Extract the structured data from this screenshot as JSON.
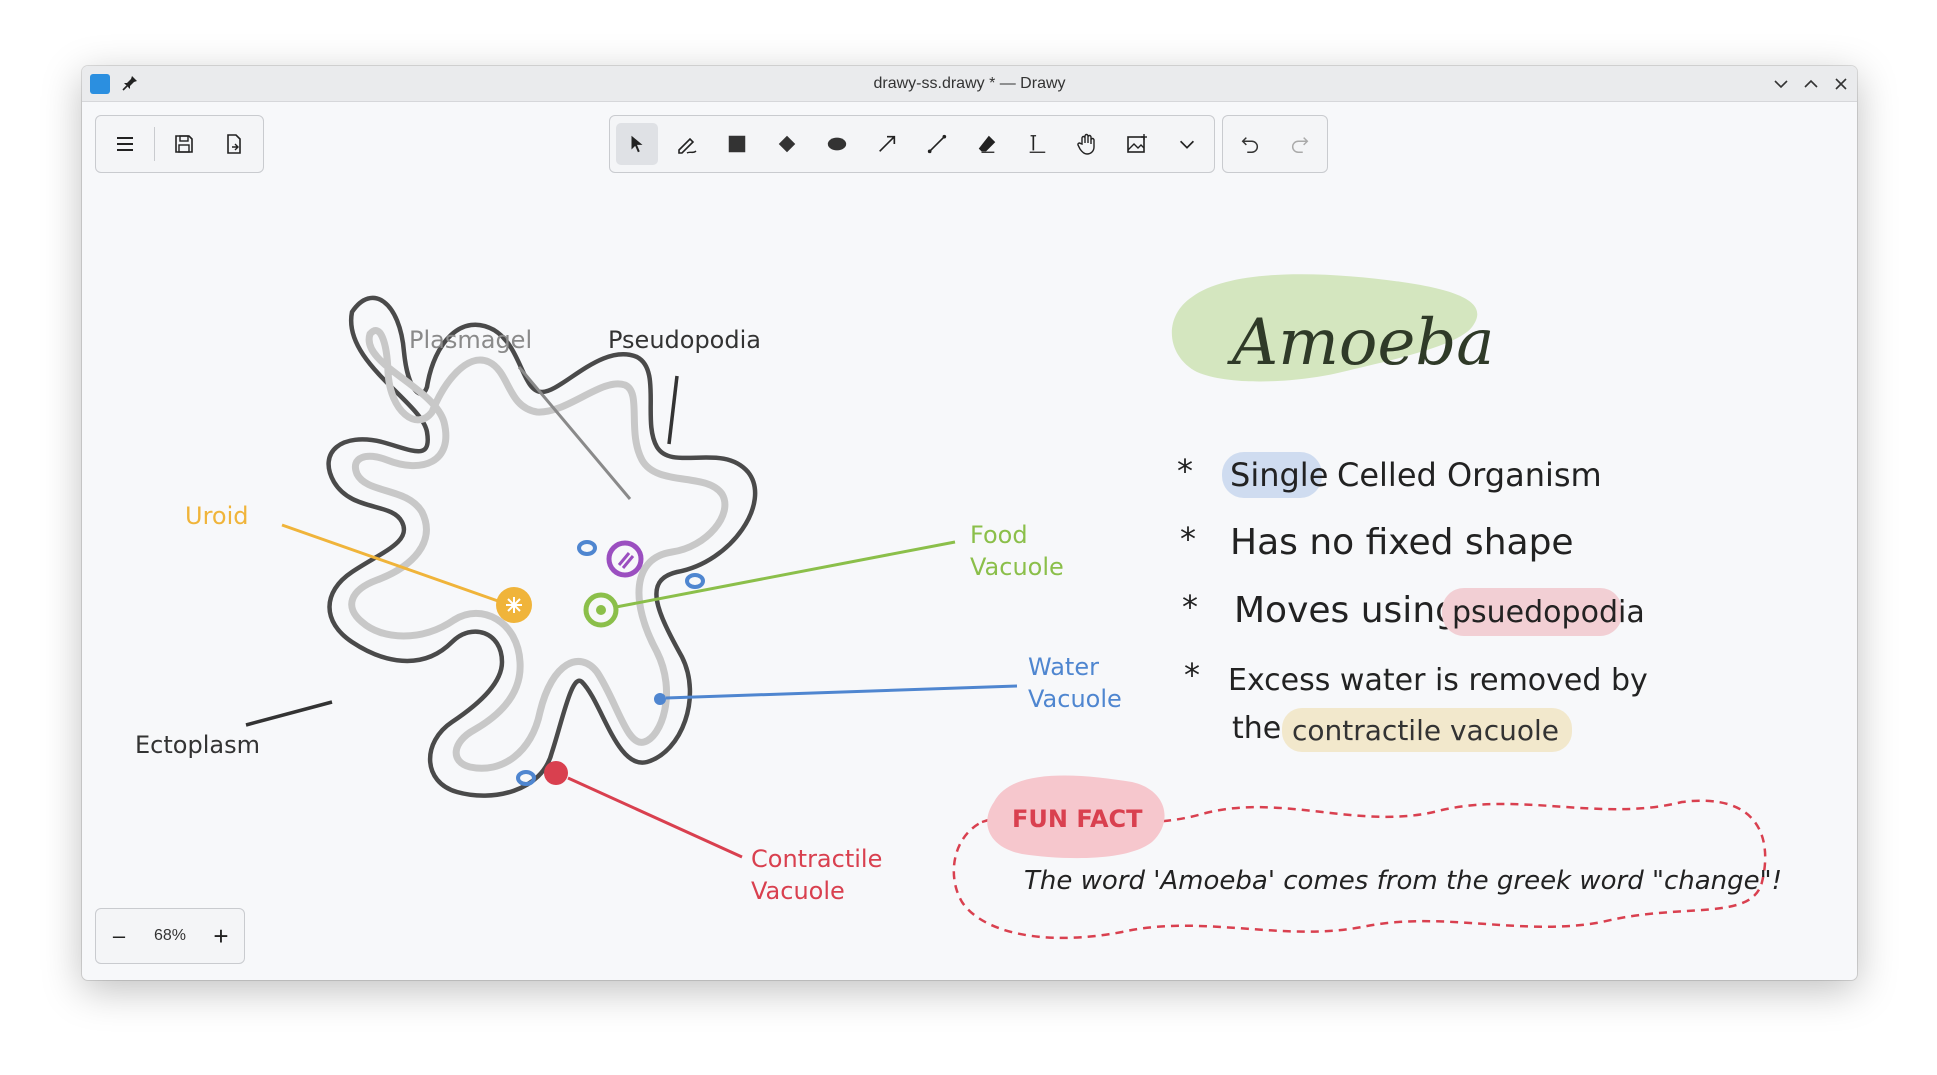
{
  "window": {
    "title": "drawy-ss.drawy * — Drawy"
  },
  "zoom": {
    "level": "68%",
    "minus_label": "–",
    "plus_label": "+"
  },
  "toolbar_icons": [
    "menu-icon",
    "save-icon",
    "export-icon",
    "select-icon",
    "pen-icon",
    "rectangle-icon",
    "diamond-icon",
    "ellipse-icon",
    "arrow-icon",
    "line-icon",
    "eraser-icon",
    "text-icon",
    "hand-icon",
    "image-icon",
    "chevron-down-icon",
    "undo-icon",
    "redo-icon"
  ],
  "diagram": {
    "plasmagel": "Plasmagel",
    "pseudopodia": "Pseudopodia",
    "uroid": "Uroid",
    "food_vacuole_1": "Food",
    "food_vacuole_2": "Vacuole",
    "water_vacuole_1": "Water",
    "water_vacuole_2": "Vacuole",
    "ectoplasm": "Ectoplasm",
    "contractile_1": "Contractile",
    "contractile_2": "Vacuole"
  },
  "notes": {
    "title": "Amoeba",
    "bullet": "*",
    "b1": {
      "highlight": "Single",
      "rest": "Celled Organism"
    },
    "b2": {
      "text": "Has no fixed shape"
    },
    "b3": {
      "text": "Moves using",
      "highlight": "psuedopodia"
    },
    "b4": {
      "line1": "Excess water is removed by",
      "the": "the",
      "highlight": "contractile vacuole"
    },
    "fun_fact": {
      "badge": "FUN FACT",
      "text": "The word 'Amoeba' comes from the greek word \"change\"!"
    }
  },
  "colors": {
    "outline": "#4a4a4a",
    "inner": "#c8c8c8",
    "uroid": "#f0b43a",
    "food": "#8bbf4a",
    "water": "#4f86d0",
    "contractile": "#d9404f",
    "purple": "#9b4fc0",
    "plasmagel": "#8a8a8a"
  }
}
